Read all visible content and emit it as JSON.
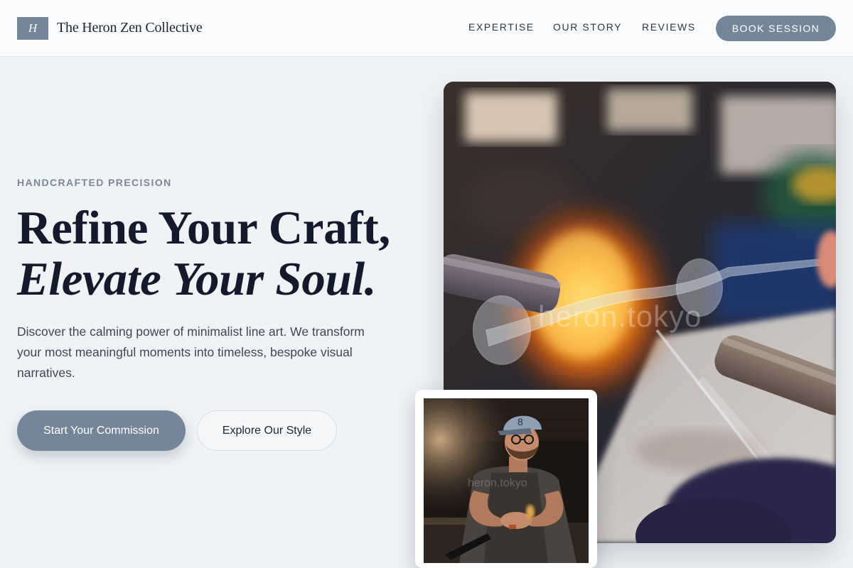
{
  "header": {
    "logo_letter": "H",
    "brand_name": "The Heron Zen Collective",
    "nav": {
      "expertise": "EXPERTISE",
      "our_story": "OUR STORY",
      "reviews": "REVIEWS"
    },
    "book_label": "BOOK SESSION"
  },
  "hero": {
    "eyebrow": "HANDCRAFTED PRECISION",
    "headline_line1": "Refine Your Craft,",
    "headline_line2": "Elevate Your Soul.",
    "lead": "Discover the calming power of minimalist line art. We transform your most meaningful moments into timeless, bespoke visual narratives.",
    "primary_cta": "Start Your Commission",
    "secondary_cta": "Explore Our Style"
  },
  "images": {
    "main_photo": {
      "subject": "glassblowing over flame",
      "watermark": "heron.tokyo"
    },
    "inset_photo": {
      "subject": "craftsman at workbench",
      "watermark": "heron.tokyo"
    }
  },
  "colors": {
    "accent": "#75869a",
    "page_bg": "#f0f3f6",
    "headline": "#121a2c",
    "body_text": "#3c4858",
    "eyebrow": "#7a8898"
  }
}
